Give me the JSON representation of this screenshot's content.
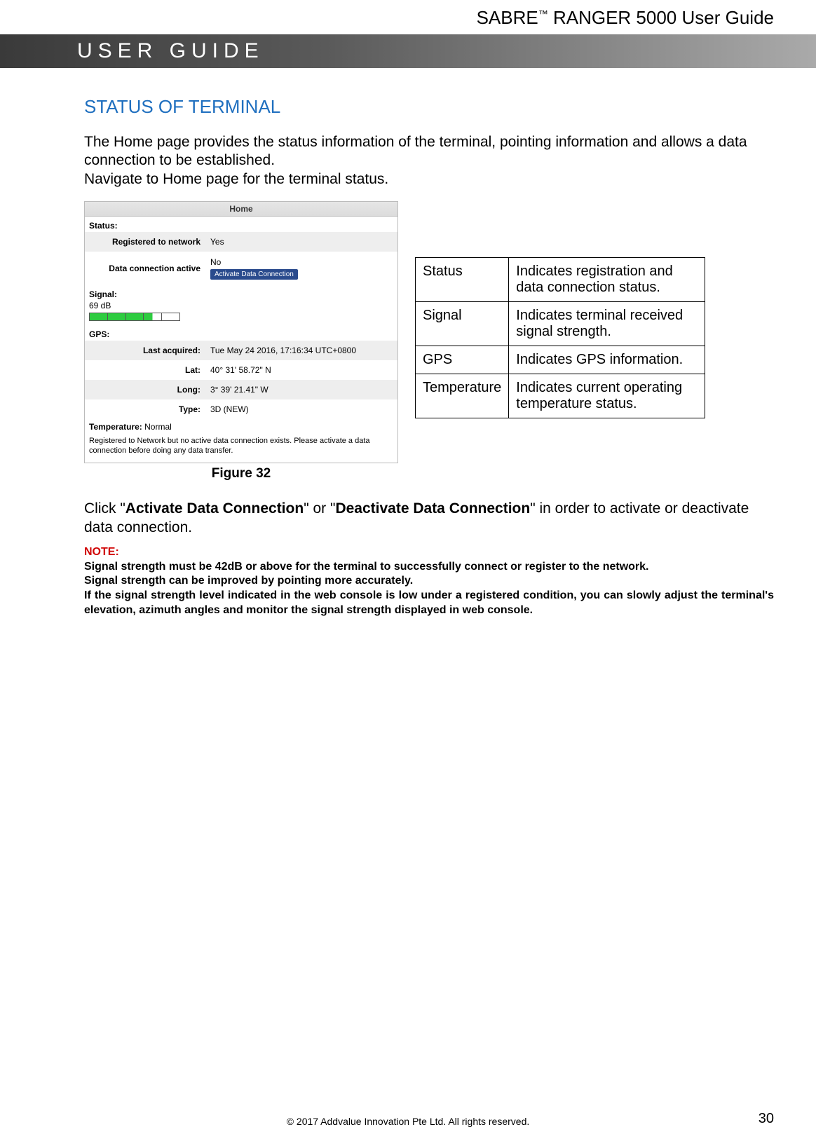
{
  "header": {
    "product": "SABRE",
    "tm": "™",
    "product2": "RANGER 5000 User Guide"
  },
  "banner": "USER GUIDE",
  "section_title": "STATUS OF TERMINAL",
  "intro_line1": "The Home page provides the status information of the terminal, pointing information and allows a data connection to be established.",
  "intro_line2": "Navigate to Home page for the terminal status.",
  "panel": {
    "title": "Home",
    "status_label": "Status:",
    "rows": {
      "registered_key": "Registered to network",
      "registered_val": "Yes",
      "data_conn_key": "Data connection active",
      "data_conn_val": "No",
      "activate_btn": "Activate Data Connection"
    },
    "signal_label": "Signal:",
    "signal_db": "69 dB",
    "gps_label": "GPS:",
    "gps": {
      "last_key": "Last acquired:",
      "last_val": "Tue May 24 2016, 17:16:34 UTC+0800",
      "lat_key": "Lat:",
      "lat_val": "40° 31' 58.72\" N",
      "long_key": "Long:",
      "long_val": "3° 39' 21.41\" W",
      "type_key": "Type:",
      "type_val": "3D (NEW)"
    },
    "temp_label": "Temperature:",
    "temp_val": "Normal",
    "footer_msg": "Registered to Network but no active data connection exists. Please activate a data connection before doing any data transfer."
  },
  "figure_caption": "Figure 32",
  "desc_table": [
    {
      "k": "Status",
      "v": "Indicates registration and data connection status."
    },
    {
      "k": "Signal",
      "v": "Indicates terminal received signal strength."
    },
    {
      "k": "GPS",
      "v": "Indicates GPS information."
    },
    {
      "k": "Temperature",
      "v": "Indicates current operating temperature status."
    }
  ],
  "after": {
    "pre": "Click \"",
    "b1": "Activate Data Connection",
    "mid": "\" or \"",
    "b2": "Deactivate Data Connection",
    "post": "\" in order to activate or deactivate data connection."
  },
  "note": {
    "label": "NOTE:",
    "l1": "Signal strength must be 42dB or above for the terminal to successfully connect or register to the network.",
    "l2": "Signal strength can be improved by pointing more accurately.",
    "l3": "If the signal strength level indicated in the web console is low under a registered condition, you can slowly adjust the terminal's elevation, azimuth angles and monitor the signal strength displayed in web console."
  },
  "footer": {
    "copyright": "© 2017 Addvalue Innovation Pte Ltd. All rights reserved.",
    "page": "30"
  }
}
